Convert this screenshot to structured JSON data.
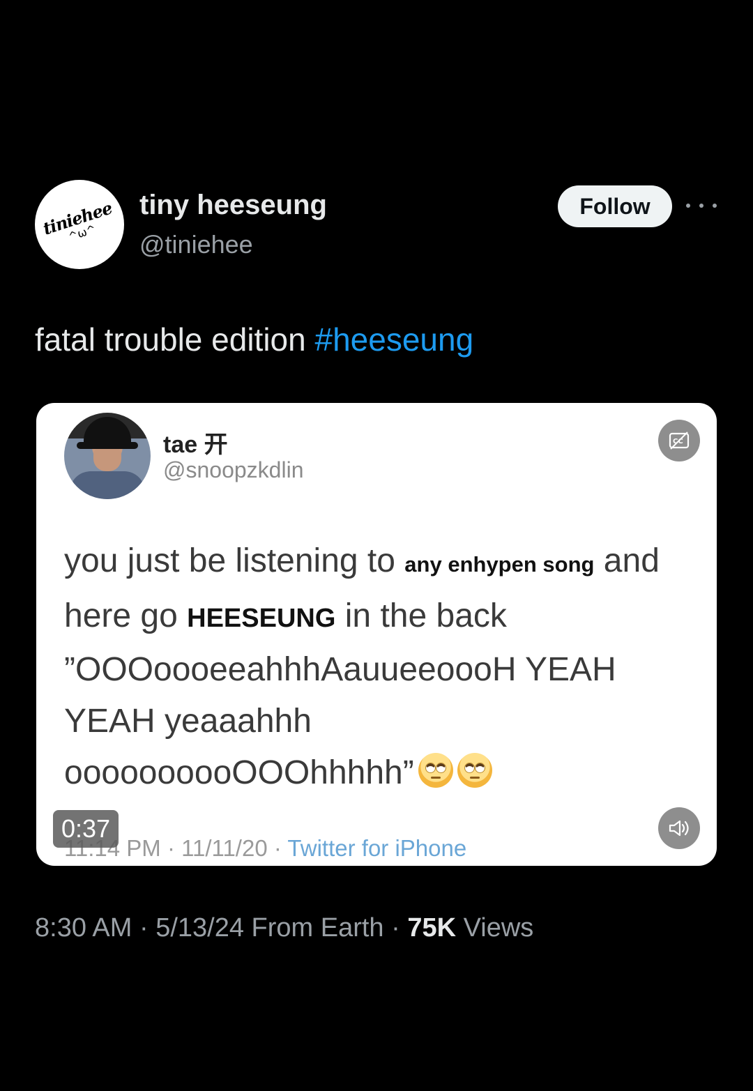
{
  "author": {
    "display_name": "tiny heeseung",
    "handle": "@tiniehee",
    "avatar_text": "tiniehee",
    "avatar_face": "^ω^",
    "follow_label": "Follow",
    "more_icon": "more-horizontal-icon"
  },
  "post": {
    "text": "fatal trouble edition ",
    "hashtag": "#heeseung"
  },
  "quoted_tweet": {
    "name": "tae 开",
    "handle": "@snoopzkdlin",
    "line1_a": "you just be listening to ",
    "line1_small": "any enhypen song",
    "line1_b": " and",
    "line2_a": "here go ",
    "line2_caps": "HEESEUNG",
    "line2_b": " in the back",
    "line3": "”OOOoooeeahhhAauueeoooH YEAH",
    "line4": "YEAH yeaaahhh",
    "line5": "oooooooooOOOhhhhh”",
    "emoji": "face-with-rolling-eyes",
    "meta_time": "11:14 PM · 11/11/20 · ",
    "meta_source": "Twitter for iPhone"
  },
  "video": {
    "duration": "0:37",
    "captions_icon": "captions-icon",
    "volume_icon": "volume-icon"
  },
  "footer": {
    "timestamp": "8:30 AM · 5/13/24 From Earth · ",
    "views_count": "75K",
    "views_label": " Views"
  },
  "colors": {
    "background": "#000000",
    "link": "#1d9bf0",
    "text": "#e7e9ea",
    "muted": "#9aa0a6"
  }
}
